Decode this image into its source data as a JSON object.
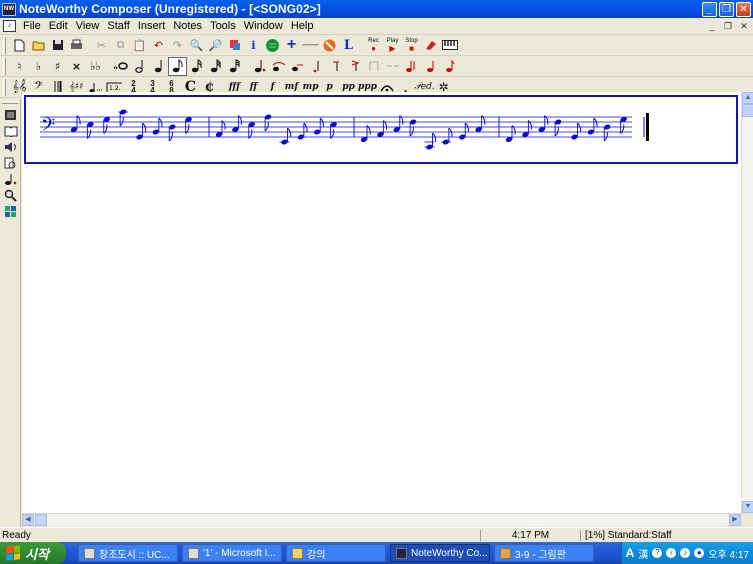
{
  "window": {
    "title": "NoteWorthy Composer (Unregistered) - [<SONG02>]",
    "app_icon_label": "NW"
  },
  "menu": {
    "items": [
      "File",
      "Edit",
      "View",
      "Staff",
      "Insert",
      "Notes",
      "Tools",
      "Window",
      "Help"
    ]
  },
  "toolbar1": {
    "rec_label": "Rec",
    "play_label": "Play",
    "stop_label": "Stop"
  },
  "toolbar3": {
    "dynamics": [
      "fff",
      "ff",
      "f",
      "mf",
      "mp",
      "p",
      "pp",
      "ppp"
    ]
  },
  "status": {
    "ready": "Ready",
    "time": "4:17 PM",
    "info": "[1%] Standard:Staff"
  },
  "taskbar": {
    "start_label": "시작",
    "tasks": [
      {
        "label": "창조도시 :: UC..."
      },
      {
        "label": "'1' - Microsoft I..."
      },
      {
        "label": "강의"
      },
      {
        "label": "NoteWorthy Co..."
      },
      {
        "label": "3-9 - 그림판"
      }
    ],
    "tray_ime": "A",
    "tray_hanja": "漢",
    "clock": "오후 4:17"
  },
  "colors": {
    "staff_border": "#1818a8",
    "note_color": "#0a0ad0",
    "title_blue": "#0055E5"
  },
  "score": {
    "clef": "bass",
    "measures": [
      {
        "notes": [
          {
            "pitch": "C3",
            "duration": "eighth"
          },
          {
            "pitch": "E3",
            "duration": "eighth"
          },
          {
            "pitch": "G3",
            "duration": "eighth"
          },
          {
            "pitch": "C4",
            "duration": "eighth"
          },
          {
            "pitch": "G2",
            "duration": "eighth"
          },
          {
            "pitch": "B2",
            "duration": "eighth"
          },
          {
            "pitch": "D3",
            "duration": "eighth"
          },
          {
            "pitch": "G3",
            "duration": "eighth"
          }
        ]
      },
      {
        "notes": [
          {
            "pitch": "A2",
            "duration": "eighth"
          },
          {
            "pitch": "C3",
            "duration": "eighth"
          },
          {
            "pitch": "E3",
            "duration": "eighth"
          },
          {
            "pitch": "A3",
            "duration": "eighth"
          },
          {
            "pitch": "E2",
            "duration": "eighth"
          },
          {
            "pitch": "G2",
            "duration": "eighth"
          },
          {
            "pitch": "B2",
            "duration": "eighth"
          },
          {
            "pitch": "E3",
            "duration": "eighth"
          }
        ]
      },
      {
        "notes": [
          {
            "pitch": "F2",
            "duration": "eighth"
          },
          {
            "pitch": "A2",
            "duration": "eighth"
          },
          {
            "pitch": "C3",
            "duration": "eighth"
          },
          {
            "pitch": "F3",
            "duration": "eighth"
          },
          {
            "pitch": "C2",
            "duration": "eighth"
          },
          {
            "pitch": "E2",
            "duration": "eighth"
          },
          {
            "pitch": "G2",
            "duration": "eighth"
          },
          {
            "pitch": "C3",
            "duration": "eighth"
          }
        ]
      },
      {
        "notes": [
          {
            "pitch": "F2",
            "duration": "eighth"
          },
          {
            "pitch": "A2",
            "duration": "eighth"
          },
          {
            "pitch": "C3",
            "duration": "eighth"
          },
          {
            "pitch": "F3",
            "duration": "eighth"
          },
          {
            "pitch": "G2",
            "duration": "eighth"
          },
          {
            "pitch": "B2",
            "duration": "eighth"
          },
          {
            "pitch": "D3",
            "duration": "eighth"
          },
          {
            "pitch": "G3",
            "duration": "eighth"
          }
        ]
      }
    ]
  }
}
